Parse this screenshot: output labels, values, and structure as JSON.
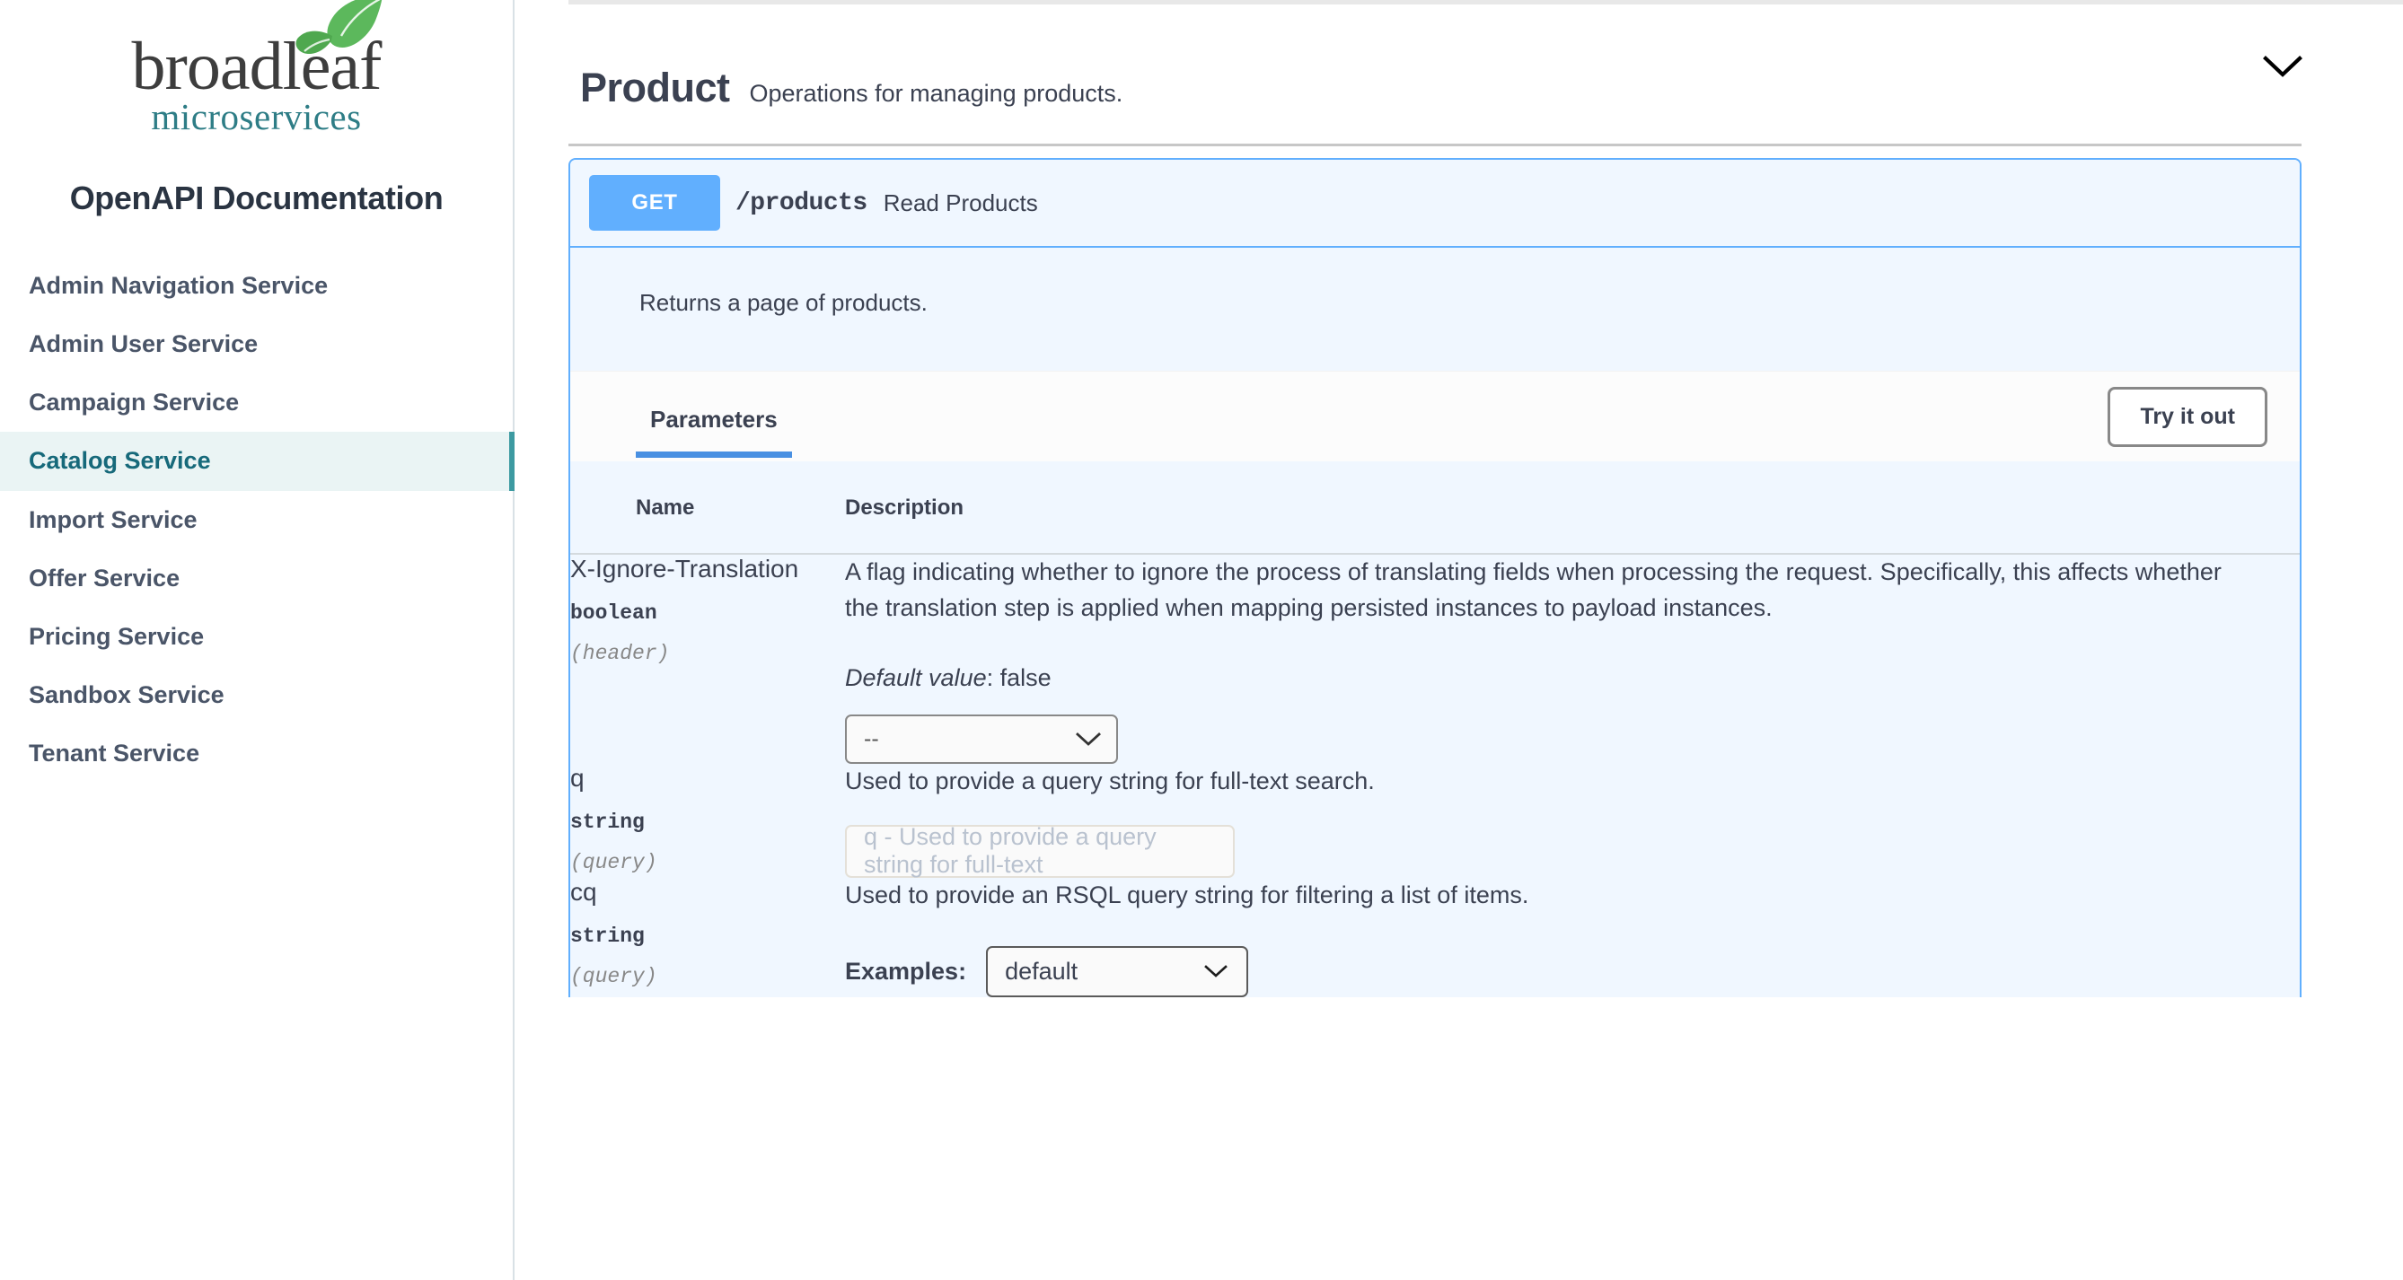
{
  "sidebar": {
    "logo": {
      "word": "broadleaf",
      "sub": "microservices",
      "leaf_icon": "leaf-icon"
    },
    "doc_title": "OpenAPI Documentation",
    "items": [
      {
        "label": "Admin Navigation Service",
        "active": false
      },
      {
        "label": "Admin User Service",
        "active": false
      },
      {
        "label": "Campaign Service",
        "active": false
      },
      {
        "label": "Catalog Service",
        "active": true
      },
      {
        "label": "Import Service",
        "active": false
      },
      {
        "label": "Offer Service",
        "active": false
      },
      {
        "label": "Pricing Service",
        "active": false
      },
      {
        "label": "Sandbox Service",
        "active": false
      },
      {
        "label": "Tenant Service",
        "active": false
      }
    ]
  },
  "tag": {
    "name": "Product",
    "description": "Operations for managing products.",
    "toggle_icon": "chevron-down-icon"
  },
  "operation": {
    "method": "GET",
    "path": "/products",
    "summary": "Read Products",
    "description": "Returns a page of products.",
    "tabs": [
      {
        "label": "Parameters",
        "active": true
      }
    ],
    "try_it_out_label": "Try it out"
  },
  "parameters_table": {
    "headers": {
      "name": "Name",
      "description": "Description"
    },
    "rows": [
      {
        "name": "X-Ignore-Translation",
        "type": "boolean",
        "in": "(header)",
        "description": "A flag indicating whether to ignore the process of translating fields when processing the request. Specifically, this affects whether the translation step is applied when mapping persisted instances to payload instances.",
        "default_label": "Default value",
        "default_value": ": false",
        "control": {
          "kind": "select",
          "value": "--",
          "icon": "chevron-down-icon"
        }
      },
      {
        "name": "q",
        "type": "string",
        "in": "(query)",
        "description": "Used to provide a query string for full-text search.",
        "control": {
          "kind": "text",
          "placeholder": "q - Used to provide a query string for full-text"
        }
      },
      {
        "name": "cq",
        "type": "string",
        "in": "(query)",
        "description": "Used to provide an RSQL query string for filtering a list of items.",
        "control": {
          "kind": "examples",
          "label": "Examples:",
          "value": "default",
          "icon": "chevron-down-icon"
        }
      }
    ]
  },
  "colors": {
    "method_blue": "#61affe",
    "accent_teal": "#16697a",
    "text_dark": "#3b4151",
    "panel_bg": "#f0f7ff"
  }
}
